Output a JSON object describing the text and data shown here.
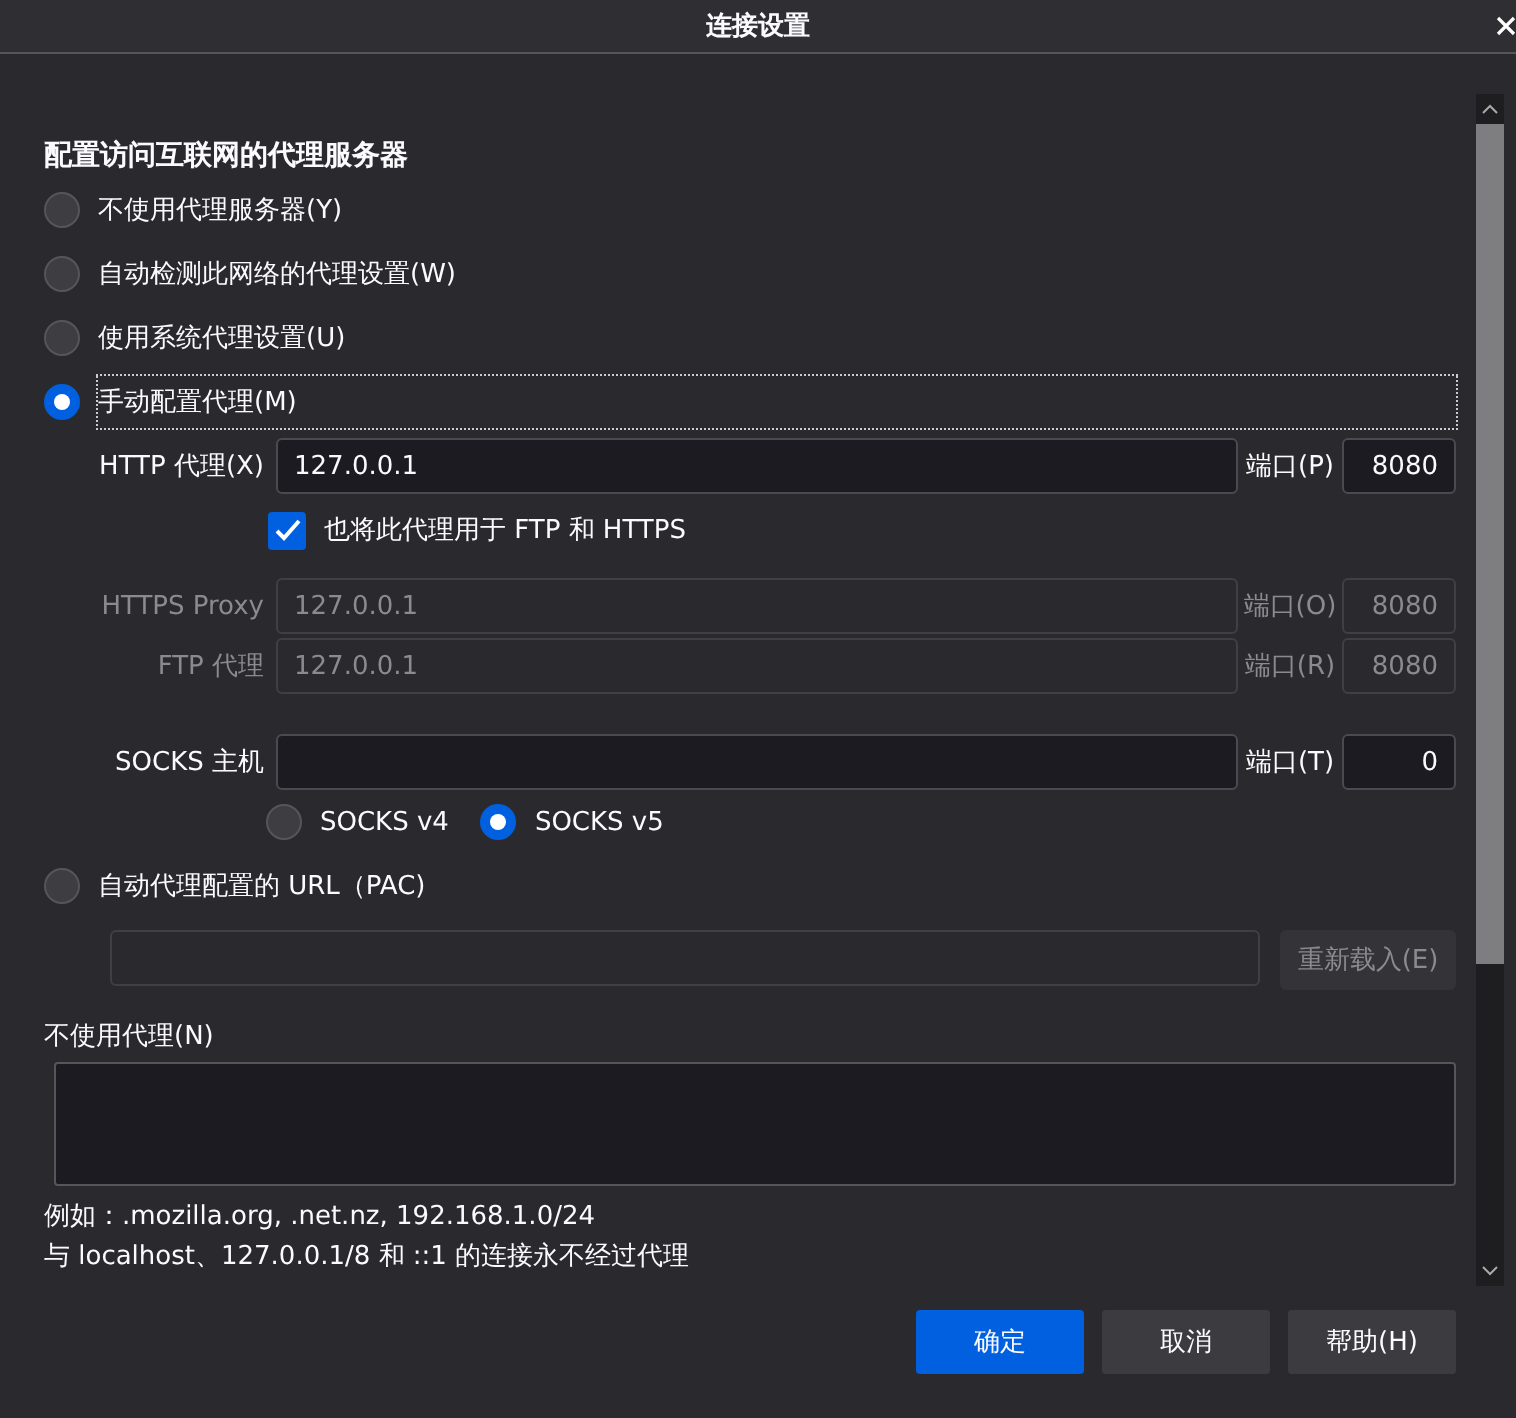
{
  "window": {
    "title": "连接设置"
  },
  "heading": "配置访问互联网的代理服务器",
  "proxy_modes": [
    {
      "label": "不使用代理服务器(Y)",
      "selected": false
    },
    {
      "label": "自动检测此网络的代理设置(W)",
      "selected": false
    },
    {
      "label": "使用系统代理设置(U)",
      "selected": false
    },
    {
      "label": "手动配置代理(M)",
      "selected": true
    }
  ],
  "manual": {
    "http": {
      "label": "HTTP 代理(X)",
      "value": "127.0.0.1",
      "port_label": "端口(P)",
      "port": "8080",
      "disabled": false
    },
    "also_use": {
      "label": "也将此代理用于 FTP 和 HTTPS",
      "checked": true
    },
    "https": {
      "label": "HTTPS Proxy",
      "value": "127.0.0.1",
      "port_label": "端口(O)",
      "port": "8080",
      "disabled": true
    },
    "ftp": {
      "label": "FTP 代理",
      "value": "127.0.0.1",
      "port_label": "端口(R)",
      "port": "8080",
      "disabled": true
    },
    "socks": {
      "label": "SOCKS 主机",
      "port_label": "端口(T)",
      "port": "0",
      "disabled": false
    },
    "socks_versions": [
      {
        "label": "SOCKS v4",
        "selected": false
      },
      {
        "label": "SOCKS v5",
        "selected": true
      }
    ]
  },
  "pac": {
    "label": "自动代理配置的 URL（PAC)",
    "selected": false,
    "reload_button": "重新载入(E)",
    "disabled": true
  },
  "no_proxy": {
    "label": "不使用代理(N)",
    "example": "例如：.mozilla.org, .net.nz, 192.168.1.0/24",
    "note": "与 localhost、127.0.0.1/8 和 ::1 的连接永不经过代理"
  },
  "buttons": [
    {
      "label": "确定",
      "kind": "primary"
    },
    {
      "label": "取消",
      "kind": "normal"
    },
    {
      "label": "帮助(H)",
      "kind": "normal"
    }
  ]
}
